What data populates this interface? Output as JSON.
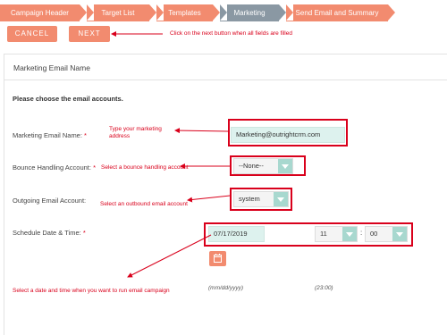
{
  "wizard": {
    "steps": [
      {
        "label": "Campaign Header",
        "state": "done"
      },
      {
        "label": "Target List",
        "state": "done"
      },
      {
        "label": "Templates",
        "state": "done"
      },
      {
        "label": "Marketing",
        "state": "active"
      },
      {
        "label": "Send Email and Summary",
        "state": "todo"
      }
    ]
  },
  "actions": {
    "cancel_label": "CANCEL",
    "next_label": "NEXT"
  },
  "annotations": {
    "next": "Click on the next button when all fields are filled",
    "email_name": "Type your marketing address",
    "bounce": "Select a bounce handling account",
    "outgoing": "Select an outbound email account",
    "schedule": "Select a date and time when you want to run email campaign"
  },
  "panel": {
    "title": "Marketing Email Name",
    "instruction": "Please choose the email accounts."
  },
  "form": {
    "email_name_label": "Marketing Email Name:",
    "email_name_value": "Marketing@outrightcrm.com",
    "bounce_label": "Bounce Handling Account:",
    "bounce_value": "--None--",
    "outgoing_label": "Outgoing Email Account:",
    "outgoing_value": "system",
    "schedule_label": "Schedule Date & Time:",
    "date_value": "07/17/2019",
    "hour_value": "11",
    "minute_value": "00",
    "date_hint": "(mm/dd/yyyy)",
    "time_hint": "(23:00)",
    "required_mark": "*"
  },
  "colors": {
    "accent": "#f28b6f",
    "active_step": "#8a98a3",
    "input_bg": "#ddf2ee",
    "caret_bg": "#a8d8cf",
    "annotation": "#d9001b"
  },
  "icons": {
    "calendar": "calendar-icon",
    "dropdown": "chevron-down-icon"
  }
}
